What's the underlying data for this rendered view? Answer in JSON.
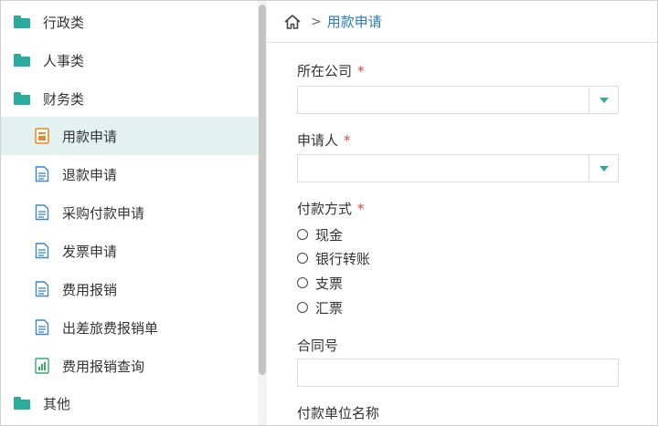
{
  "sidebar": {
    "items": [
      {
        "label": "行政类",
        "kind": "folder"
      },
      {
        "label": "人事类",
        "kind": "folder"
      },
      {
        "label": "财务类",
        "kind": "folder-open"
      },
      {
        "label": "用款申请",
        "kind": "doc-active"
      },
      {
        "label": "退款申请",
        "kind": "doc"
      },
      {
        "label": "采购付款申请",
        "kind": "doc"
      },
      {
        "label": "发票申请",
        "kind": "doc"
      },
      {
        "label": "费用报销",
        "kind": "doc"
      },
      {
        "label": "出差旅费报销单",
        "kind": "doc"
      },
      {
        "label": "费用报销查询",
        "kind": "chart-doc"
      },
      {
        "label": "其他",
        "kind": "folder"
      }
    ]
  },
  "breadcrumb": {
    "separator": ">",
    "current": "用款申请"
  },
  "form": {
    "company": {
      "label": "所在公司",
      "required": "*",
      "value": ""
    },
    "applicant": {
      "label": "申请人",
      "required": "*",
      "value": ""
    },
    "payment_method": {
      "label": "付款方式",
      "required": "*",
      "options": [
        "现金",
        "银行转账",
        "支票",
        "汇票"
      ]
    },
    "contract_no": {
      "label": "合同号",
      "value": ""
    },
    "payee_name": {
      "label": "付款单位名称"
    }
  },
  "colors": {
    "accent": "#2aab9e",
    "link": "#2a7ab6",
    "required": "#e0413b",
    "selected_bg": "#e3f2f0"
  }
}
